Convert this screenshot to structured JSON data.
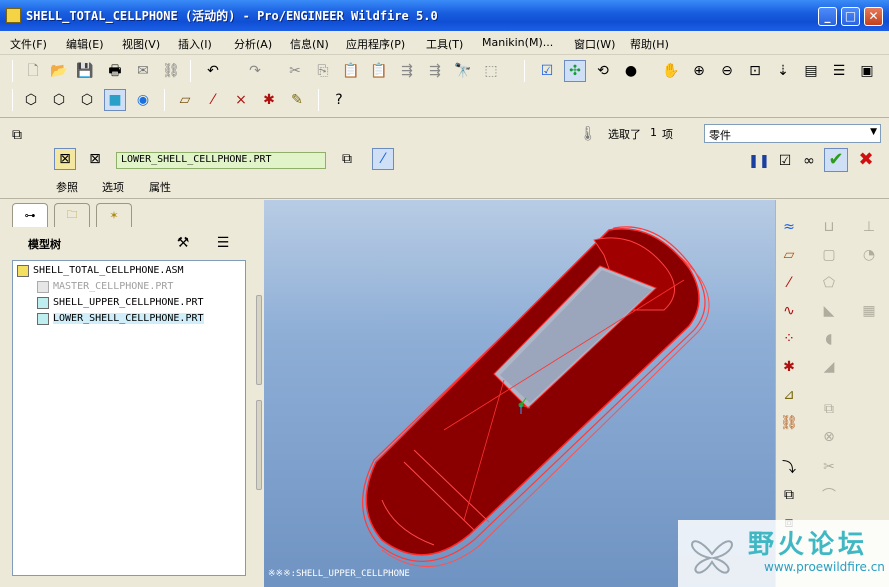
{
  "window": {
    "title": "SHELL_TOTAL_CELLPHONE (活动的) - Pro/ENGINEER Wildfire 5.0",
    "minimize": "_",
    "maximize": "□",
    "close": "✕"
  },
  "menu": [
    "文件(F)",
    "编辑(E)",
    "视图(V)",
    "插入(I)",
    "分析(A)",
    "信息(N)",
    "应用程序(P)",
    "工具(T)",
    "Manikin(M)...",
    "窗口(W)",
    "帮助(H)"
  ],
  "dashboard": {
    "reference_value": "LOWER_SHELL_CELLPHONE.PRT",
    "selection_label": "选取了",
    "selection_count": "1",
    "selection_unit": "项",
    "type_value": "零件",
    "tabs": [
      "参照",
      "选项",
      "属性"
    ]
  },
  "model_tree": {
    "title": "模型树",
    "items": [
      {
        "label": "SHELL_TOTAL_CELLPHONE.ASM",
        "state": "assembly"
      },
      {
        "label": "MASTER_CELLPHONE.PRT",
        "state": "suppressed"
      },
      {
        "label": "SHELL_UPPER_CELLPHONE.PRT",
        "state": "normal"
      },
      {
        "label": "LOWER_SHELL_CELLPHONE.PRT",
        "state": "selected"
      }
    ]
  },
  "viewport": {
    "status_text": "※※※:SHELL_UPPER_CELLPHONE",
    "model_color": "#8a0000",
    "edge_color": "#ff3030"
  },
  "watermark": {
    "title": "野火论坛",
    "url": "www.proewildfire.cn"
  },
  "colors": {
    "title_bar": "#1a5fe0",
    "accent_green": "#e1f3c9",
    "ok_green": "#2e9b1e",
    "cancel_red": "#d01010"
  }
}
